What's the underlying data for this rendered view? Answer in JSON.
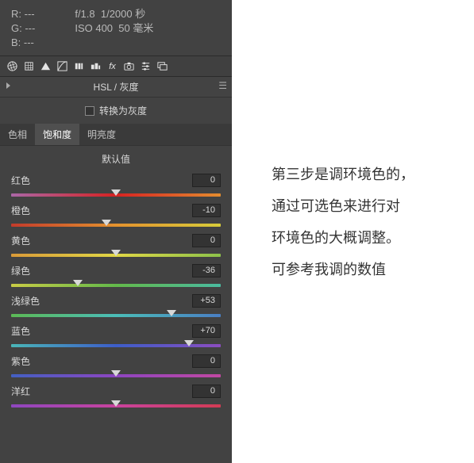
{
  "info": {
    "r": "R: ---",
    "g": "G: ---",
    "b": "B: ---",
    "aperture": "f/1.8",
    "shutter": "1/2000 秒",
    "iso": "ISO 400",
    "focal": "50 毫米"
  },
  "panel": {
    "title": "HSL / 灰度",
    "convert": "转换为灰度"
  },
  "tabs": {
    "hue": "色相",
    "saturation": "饱和度",
    "luminance": "明亮度"
  },
  "defaults_label": "默认值",
  "sliders": [
    {
      "label": "红色",
      "value": "0",
      "pos": 50,
      "grad": "linear-gradient(to right,#ab66a6,#d62222,#e48c2e)"
    },
    {
      "label": "橙色",
      "value": "-10",
      "pos": 45.5,
      "grad": "linear-gradient(to right,#c33b2b,#e4922e,#d7cc3a)"
    },
    {
      "label": "黄色",
      "value": "0",
      "pos": 50,
      "grad": "linear-gradient(to right,#d99a38,#e0d746,#8dc24a)"
    },
    {
      "label": "绿色",
      "value": "-36",
      "pos": 32,
      "grad": "linear-gradient(to right,#c9cc45,#63b94a,#4abba0)"
    },
    {
      "label": "浅绿色",
      "value": "+53",
      "pos": 76.5,
      "grad": "linear-gradient(to right,#5cba55,#4bbdb8,#4a7fc4)"
    },
    {
      "label": "蓝色",
      "value": "+70",
      "pos": 85,
      "grad": "linear-gradient(to right,#4ab6b8,#3d5ec9,#8b4dc0)"
    },
    {
      "label": "紫色",
      "value": "0",
      "pos": 50,
      "grad": "linear-gradient(to right,#4360c3,#8d46c1,#c248a2)"
    },
    {
      "label": "洋红",
      "value": "0",
      "pos": 50,
      "grad": "linear-gradient(to right,#8e47c0,#c9439e,#d33b54)"
    }
  ],
  "side_text": {
    "l1": "第三步是调环境色的，",
    "l2": "通过可选色来进行对",
    "l3": "环境色的大概调整。",
    "l4": "可参考我调的数值"
  }
}
